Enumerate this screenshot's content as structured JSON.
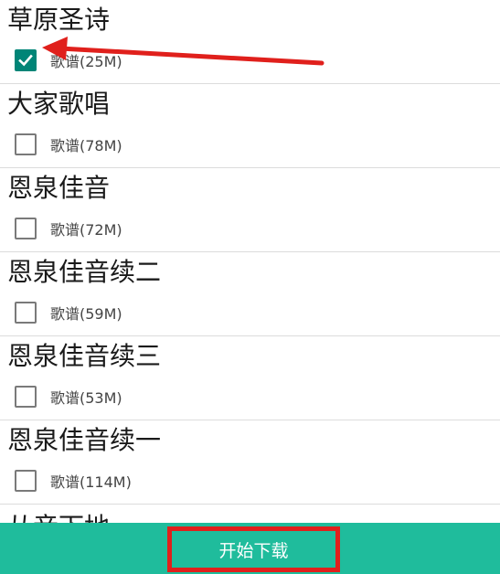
{
  "groups": [
    {
      "title": "草原圣诗",
      "option_label": "歌谱(25M)",
      "checked": true
    },
    {
      "title": "大家歌唱",
      "option_label": "歌谱(78M)",
      "checked": false
    },
    {
      "title": "恩泉佳音",
      "option_label": "歌谱(72M)",
      "checked": false
    },
    {
      "title": "恩泉佳音续二",
      "option_label": "歌谱(59M)",
      "checked": false
    },
    {
      "title": "恩泉佳音续三",
      "option_label": "歌谱(53M)",
      "checked": false
    },
    {
      "title": "恩泉佳音续一",
      "option_label": "歌谱(114M)",
      "checked": false
    },
    {
      "title": "从音下地"
    }
  ],
  "bottom_bar": {
    "download_label": "开始下载"
  },
  "colors": {
    "accent": "#008577",
    "bottom_bar": "#1fbc9c",
    "annotation_red": "#e0201c"
  },
  "icons": {
    "checkbox_checked": "check-icon",
    "annotation": "arrow-left-icon"
  }
}
